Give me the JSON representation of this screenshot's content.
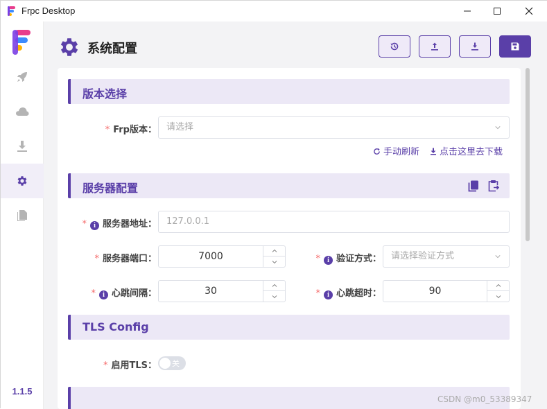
{
  "window": {
    "title": "Frpc Desktop"
  },
  "sidebar": {
    "version": "1.1.5",
    "items": [
      {
        "name": "rocket-icon"
      },
      {
        "name": "cloud-icon"
      },
      {
        "name": "download-icon"
      },
      {
        "name": "gear-icon"
      },
      {
        "name": "file-icon"
      }
    ]
  },
  "header": {
    "title": "系统配置",
    "buttons": [
      "history-icon",
      "upload-icon",
      "download-icon",
      "save-icon"
    ]
  },
  "sections": {
    "version": {
      "title": "版本选择",
      "frp_version_label": "Frp版本：",
      "frp_version_placeholder": "请选择",
      "refresh_link": "手动刷新",
      "download_link": "点击这里去下载"
    },
    "server": {
      "title": "服务器配置",
      "address_label": "服务器地址：",
      "address_placeholder": "127.0.0.1",
      "port_label": "服务器端口：",
      "port_value": "7000",
      "auth_label": "验证方式：",
      "auth_placeholder": "请选择验证方式",
      "heartbeat_interval_label": "心跳间隔：",
      "heartbeat_interval_value": "30",
      "heartbeat_timeout_label": "心跳超时：",
      "heartbeat_timeout_value": "90"
    },
    "tls": {
      "title": "TLS Config",
      "enable_label": "启用TLS：",
      "switch_text": "关",
      "enabled": false
    }
  },
  "required_mark": "*",
  "info_mark": "i",
  "watermark": "CSDN @m0_53389347",
  "colors": {
    "accent": "#5a3fa8",
    "section_bg": "#ece8f6",
    "required": "#f56c6c"
  }
}
